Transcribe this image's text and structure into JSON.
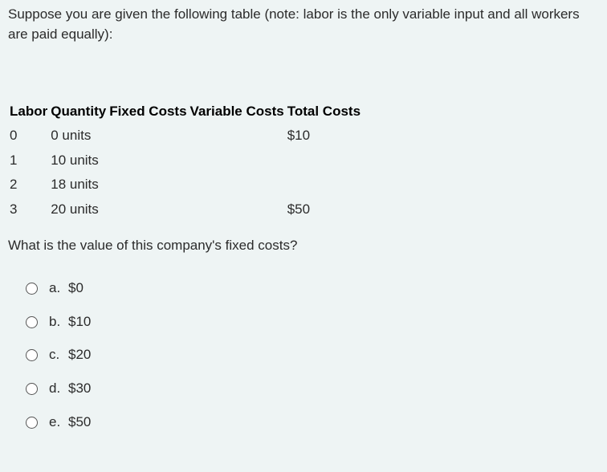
{
  "intro": "Suppose you are given the following table (note:  labor is the only variable input and all workers are paid equally):",
  "table": {
    "headers": {
      "labor": "Labor",
      "quantity": "Quantity",
      "fixed": "Fixed Costs",
      "variable": "Variable Costs",
      "total": "Total Costs"
    },
    "rows": [
      {
        "labor": "0",
        "quantity": "0 units",
        "fixed": "",
        "variable": "",
        "total": "$10"
      },
      {
        "labor": "1",
        "quantity": "10 units",
        "fixed": "",
        "variable": "",
        "total": ""
      },
      {
        "labor": "2",
        "quantity": "18 units",
        "fixed": "",
        "variable": "",
        "total": ""
      },
      {
        "labor": "3",
        "quantity": "20 units",
        "fixed": "",
        "variable": "",
        "total": "$50"
      }
    ]
  },
  "question": "What is the value of this company's fixed costs?",
  "options": [
    {
      "letter": "a.",
      "text": "$0"
    },
    {
      "letter": "b.",
      "text": "$10"
    },
    {
      "letter": "c.",
      "text": "$20"
    },
    {
      "letter": "d.",
      "text": "$30"
    },
    {
      "letter": "e.",
      "text": "$50"
    }
  ]
}
